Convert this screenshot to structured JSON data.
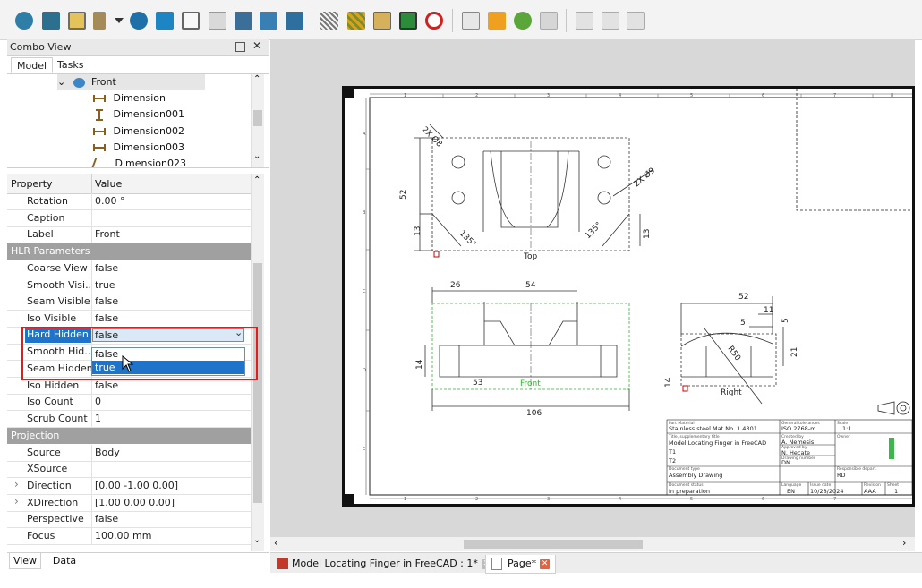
{
  "combo": {
    "title": "Combo View",
    "tabs": [
      "Model",
      "Tasks"
    ],
    "tree": [
      {
        "label": "Front",
        "icon": "view-icon"
      },
      {
        "label": "Dimension",
        "icon": "dimension-horizontal-icon"
      },
      {
        "label": "Dimension001",
        "icon": "dimension-vertical-icon"
      },
      {
        "label": "Dimension002",
        "icon": "dimension-horizontal-icon"
      },
      {
        "label": "Dimension003",
        "icon": "dimension-horizontal-icon"
      },
      {
        "label": "Dimension023",
        "icon": "dimension-angular-icon"
      }
    ],
    "bottom_tabs": [
      "View",
      "Data"
    ]
  },
  "props": {
    "header": {
      "property": "Property",
      "value": "Value"
    },
    "rows": [
      {
        "key": "Rotation",
        "value": "0.00 °"
      },
      {
        "key": "Caption",
        "value": ""
      },
      {
        "key": "Label",
        "value": "Front"
      },
      {
        "group": "HLR Parameters"
      },
      {
        "key": "Coarse View",
        "value": "false"
      },
      {
        "key": "Smooth Visi...",
        "value": "true"
      },
      {
        "key": "Seam Visible",
        "value": "false"
      },
      {
        "key": "Iso Visible",
        "value": "false"
      },
      {
        "key": "Hard Hidden",
        "value": "false",
        "selected": true
      },
      {
        "key": "Smooth Hid...",
        "value": "false"
      },
      {
        "key": "Seam Hidden",
        "value": "false"
      },
      {
        "key": "Iso Hidden",
        "value": "false"
      },
      {
        "key": "Iso Count",
        "value": "0"
      },
      {
        "key": "Scrub Count",
        "value": "1"
      },
      {
        "group": "Projection"
      },
      {
        "key": "Source",
        "value": "Body"
      },
      {
        "key": "XSource",
        "value": ""
      },
      {
        "key": "Direction",
        "value": "[0.00 -1.00 0.00]",
        "expandable": true
      },
      {
        "key": "XDirection",
        "value": "[1.00 0.00 0.00]",
        "expandable": true
      },
      {
        "key": "Perspective",
        "value": "false"
      },
      {
        "key": "Focus",
        "value": "100.00 mm"
      }
    ],
    "dropdown": {
      "current": "false",
      "options": [
        "false",
        "true"
      ],
      "highlighted": "true"
    }
  },
  "drawing": {
    "views": {
      "top": "Top",
      "front": "Front",
      "right": "Right"
    },
    "dims": {
      "hole_top_left": "2X Ø8",
      "hole_right": "2X Ø9",
      "d52_left": "52",
      "d13_left": "13",
      "d13_bottom": "13",
      "angle135_1": "135°",
      "angle135_2": "135°",
      "d13_right": "13",
      "d26": "26",
      "d54": "54",
      "d14": "14",
      "d53": "53",
      "d106": "106",
      "d52_right": "52",
      "d11": "11",
      "d5": "5",
      "d5v": "5",
      "d21": "21",
      "r50": "R50",
      "d14r": "14"
    },
    "titleblock": {
      "part_material_label": "Part Material",
      "part_material": "Stainless steel Mat No. 1.4301",
      "general_tol_label": "General tolerances",
      "general_tol": "ISO 2768-m",
      "scale_label": "Scale",
      "scale": "1:1",
      "title_label": "Title, supplementary title",
      "title": "Model Locating Finger in FreeCAD",
      "line1": "T1",
      "line2": "T2",
      "created_label": "Created by",
      "created": "A. Nemesis",
      "approved_label": "Approved by",
      "approved": "N. Hecate",
      "owner_label": "Owner",
      "doc_type_label": "Document type",
      "doc_type": "Assembly Drawing",
      "drawing_no_label": "Drawing number",
      "drawing_no": "DN",
      "resp_label": "Responsible depart.",
      "resp": "RD",
      "doc_status_label": "Document status",
      "doc_status": "In preparation",
      "lang_label": "Language",
      "lang": "EN",
      "issue_label": "Issue date",
      "issue": "10/28/2024",
      "rev_label": "Revision",
      "rev": "AAA",
      "sheet_label": "Sheet",
      "sheet": "1"
    },
    "border_cols": [
      "1",
      "2",
      "3",
      "4",
      "5",
      "6",
      "7",
      "8"
    ],
    "border_rows": [
      "A",
      "B",
      "C",
      "D",
      "E",
      "F"
    ]
  },
  "doc_tabs": [
    {
      "label": "Model Locating Finger in FreeCAD : 1*",
      "close_color": "#bdbdbd"
    },
    {
      "label": "Page*",
      "close_color": "#e8603c"
    }
  ]
}
